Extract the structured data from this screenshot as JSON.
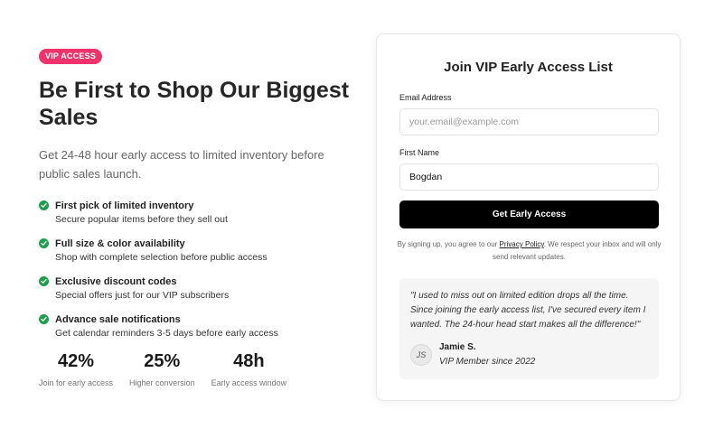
{
  "hero": {
    "badge": "VIP ACCESS",
    "headline": "Be First to Shop Our Biggest Sales",
    "subheadline": "Get 24-48 hour early access to limited inventory before public sales launch."
  },
  "features": [
    {
      "title": "First pick of limited inventory",
      "desc": "Secure popular items before they sell out",
      "icon": "check-circle-icon"
    },
    {
      "title": "Full size & color availability",
      "desc": "Shop with complete selection before public access",
      "icon": "check-circle-icon"
    },
    {
      "title": "Exclusive discount codes",
      "desc": "Special offers just for our VIP subscribers",
      "icon": "check-circle-icon"
    },
    {
      "title": "Advance sale notifications",
      "desc": "Get calendar reminders 3-5 days before early access",
      "icon": "check-circle-icon"
    }
  ],
  "stats": [
    {
      "value": "42%",
      "label": "Join for early access"
    },
    {
      "value": "25%",
      "label": "Higher conversion"
    },
    {
      "value": "48h",
      "label": "Early access window"
    }
  ],
  "form": {
    "title": "Join VIP Early Access List",
    "email_label": "Email Address",
    "email_placeholder": "your.email@example.com",
    "email_value": "",
    "firstname_label": "First Name",
    "firstname_value": "Bogdan",
    "submit_label": "Get Early Access",
    "disclaimer_prefix": "By signing up, you agree to our ",
    "privacy_link": "Privacy Policy",
    "disclaimer_suffix": ". We respect your inbox and will only send relevant updates."
  },
  "testimonial": {
    "quote": "\"I used to miss out on limited edition drops all the time. Since joining the early access list, I've secured every item I wanted. The 24-hour head start makes all the difference!\"",
    "initials": "JS",
    "name": "Jamie S.",
    "role": "VIP Member since 2022"
  },
  "colors": {
    "badge": "#f0336b",
    "check": "#1e9e4a",
    "button": "#000000"
  }
}
